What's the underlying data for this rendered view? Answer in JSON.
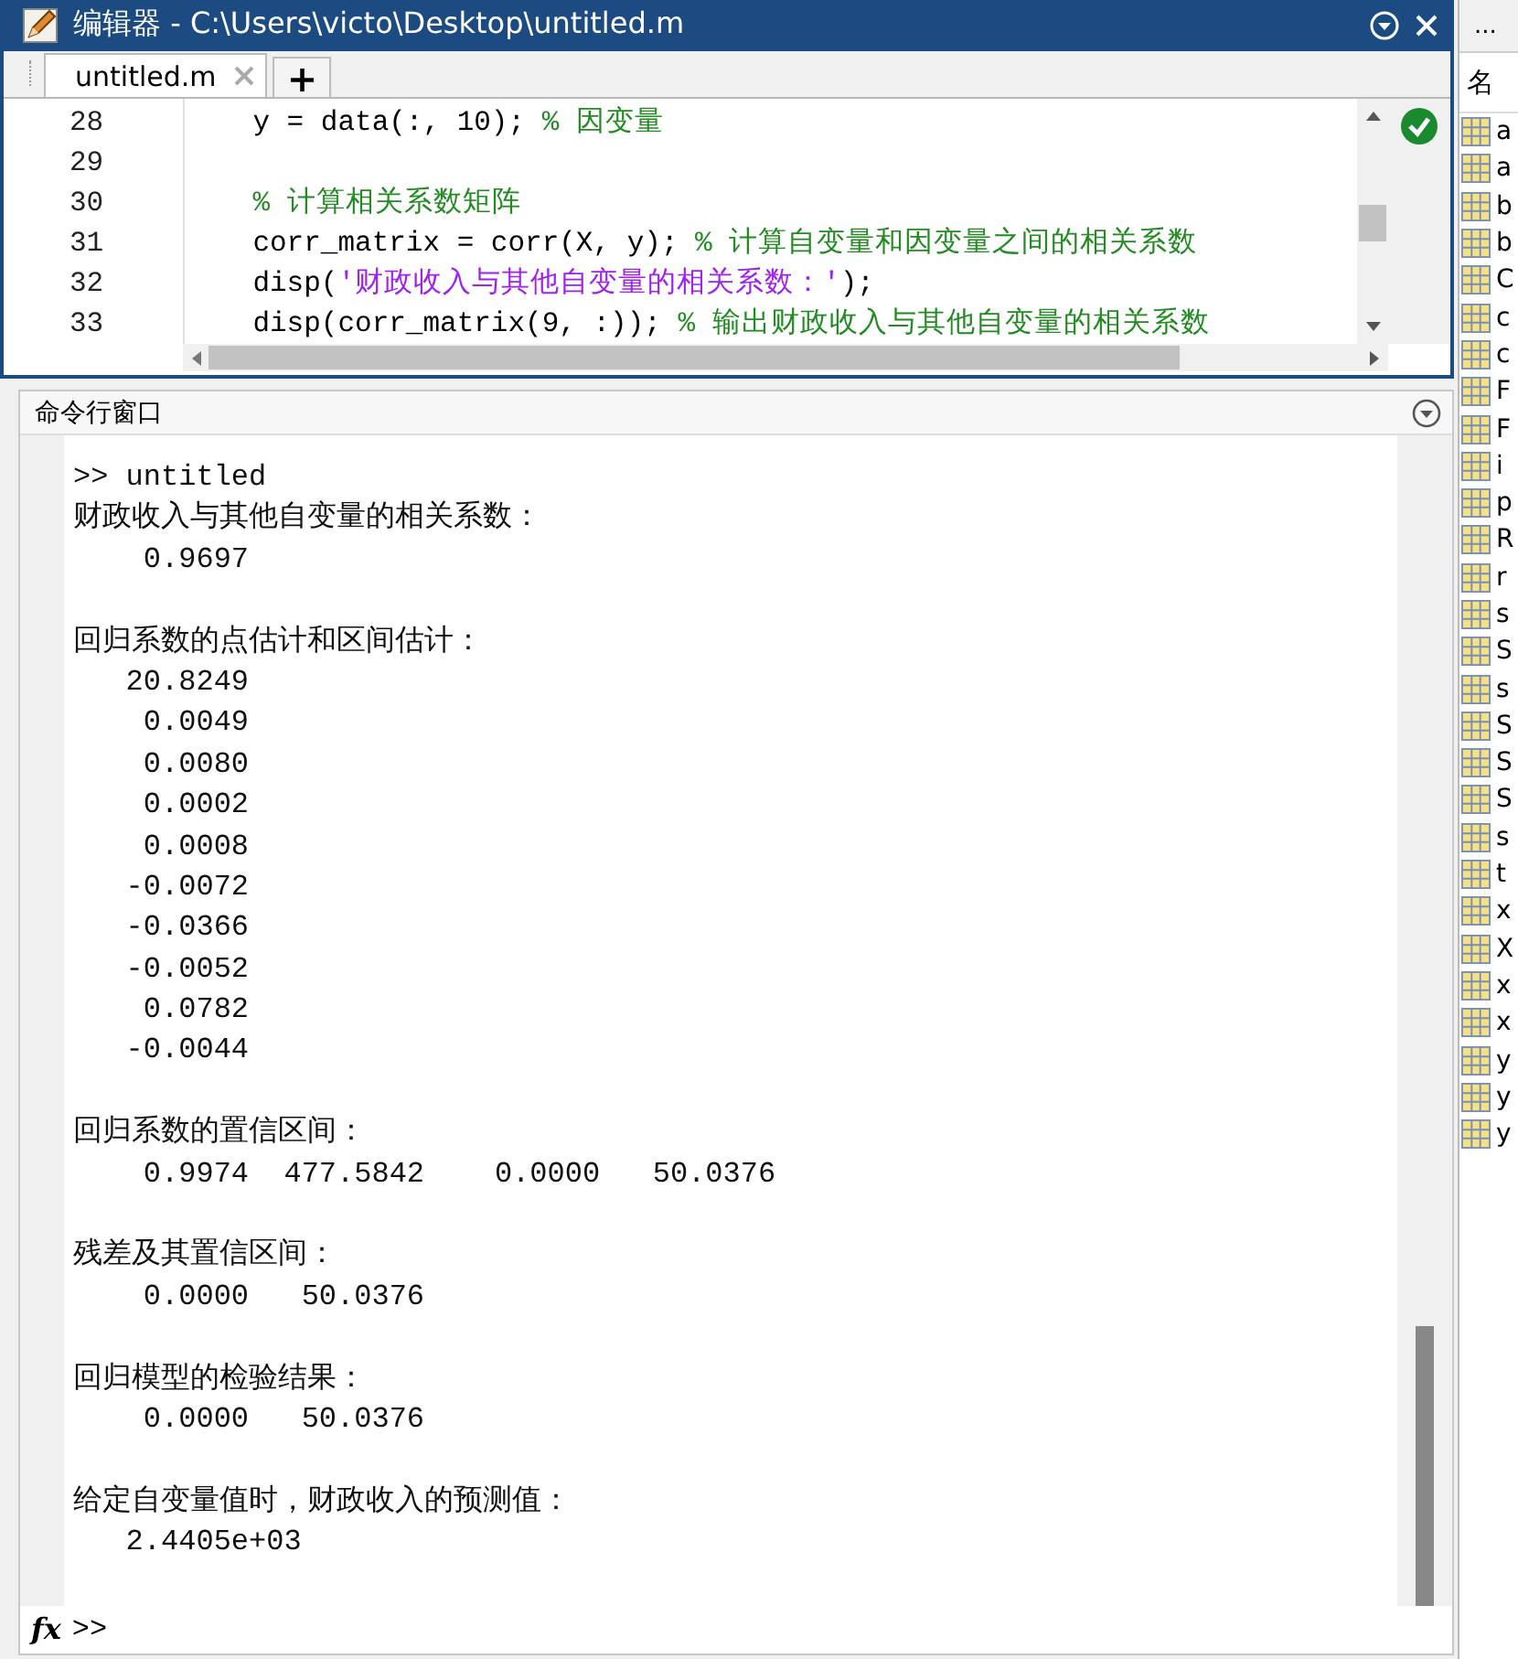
{
  "editor": {
    "title": "编辑器 - C:\\Users\\victo\\Desktop\\untitled.m",
    "tabs": [
      {
        "label": "untitled.m",
        "selected": true
      }
    ],
    "add_tab": "+",
    "lines": [
      {
        "number": "28",
        "segments": [
          {
            "kind": "code",
            "text": "    y = data(:, 10); "
          },
          {
            "kind": "comment",
            "text": "% 因变量"
          }
        ]
      },
      {
        "number": "29"
      },
      {
        "number": "30",
        "segments": [
          {
            "kind": "comment",
            "text": "    % 计算相关系数矩阵"
          }
        ]
      },
      {
        "number": "31",
        "segments": [
          {
            "kind": "code",
            "text": "    corr_matrix = corr(X, y); "
          },
          {
            "kind": "comment",
            "text": "% 计算自变量和因变量之间的相关系数"
          }
        ]
      },
      {
        "number": "32",
        "segments": [
          {
            "kind": "code",
            "text": "    disp("
          },
          {
            "kind": "string",
            "text": "'财政收入与其他自变量的相关系数：'"
          },
          {
            "kind": "code",
            "text": ");"
          }
        ]
      },
      {
        "number": "33",
        "segments": [
          {
            "kind": "code",
            "text": "    disp(corr_matrix(9, :)); "
          },
          {
            "kind": "comment",
            "text": "% 输出财政收入与其他自变量的相关系数"
          }
        ]
      }
    ],
    "analysis_ok": true
  },
  "command_window": {
    "title": "命令行窗口",
    "blocks": [
      [
        ">> untitled",
        "财政收入与其他自变量的相关系数：",
        "    0.9697"
      ],
      [
        "回归系数的点估计和区间估计：",
        "   20.8249",
        "    0.0049",
        "    0.0080",
        "    0.0002",
        "    0.0008",
        "   -0.0072",
        "   -0.0366",
        "   -0.0052",
        "    0.0782",
        "   -0.0044"
      ],
      [
        "回归系数的置信区间：",
        "    0.9974  477.5842    0.0000   50.0376"
      ],
      [
        "残差及其置信区间：",
        "    0.0000   50.0376"
      ],
      [
        "回归模型的检验结果：",
        "    0.0000   50.0376"
      ],
      [
        "给定自变量值时，财政收入的预测值：",
        "   2.4405e+03"
      ]
    ],
    "fx": "fx",
    "prompt": ">>"
  },
  "workspace": {
    "menu": "...",
    "column": "名",
    "items": [
      "a",
      "a",
      "b",
      "b",
      "C",
      "c",
      "c",
      "F",
      "F",
      "i",
      "p",
      "R",
      "r",
      "s",
      "S",
      "s",
      "S",
      "S",
      "S",
      "s",
      "t",
      "x",
      "X",
      "x",
      "x",
      "y",
      "y",
      "y"
    ]
  }
}
